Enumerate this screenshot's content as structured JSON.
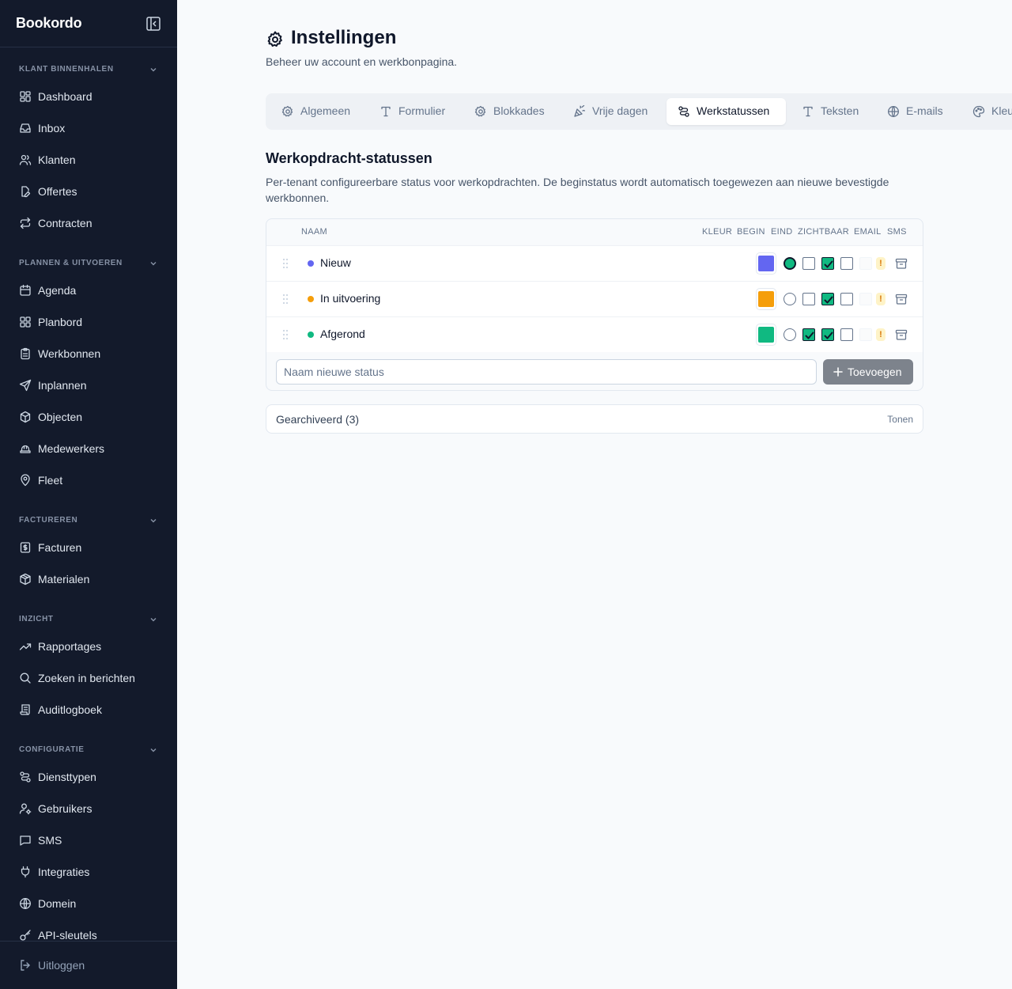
{
  "app": {
    "name": "Bookordo"
  },
  "sidebar": {
    "sections": [
      {
        "title": "Klant binnenhalen",
        "items": [
          {
            "label": "Dashboard",
            "icon": "dashboard-icon"
          },
          {
            "label": "Inbox",
            "icon": "inbox-icon"
          },
          {
            "label": "Klanten",
            "icon": "users-icon"
          },
          {
            "label": "Offertes",
            "icon": "file-edit-icon"
          },
          {
            "label": "Contracten",
            "icon": "repeat-icon"
          }
        ]
      },
      {
        "title": "Plannen & uitvoeren",
        "items": [
          {
            "label": "Agenda",
            "icon": "calendar-icon"
          },
          {
            "label": "Planbord",
            "icon": "board-icon"
          },
          {
            "label": "Werkbonnen",
            "icon": "clipboard-icon"
          },
          {
            "label": "Inplannen",
            "icon": "send-icon"
          },
          {
            "label": "Objecten",
            "icon": "objects-icon"
          },
          {
            "label": "Medewerkers",
            "icon": "hardhat-icon"
          },
          {
            "label": "Fleet",
            "icon": "map-pin-icon"
          }
        ]
      },
      {
        "title": "Factureren",
        "items": [
          {
            "label": "Facturen",
            "icon": "invoice-icon"
          },
          {
            "label": "Materialen",
            "icon": "package-icon"
          }
        ]
      },
      {
        "title": "Inzicht",
        "items": [
          {
            "label": "Rapportages",
            "icon": "trending-icon"
          },
          {
            "label": "Zoeken in berichten",
            "icon": "search-icon"
          },
          {
            "label": "Auditlogboek",
            "icon": "scroll-icon"
          }
        ]
      },
      {
        "title": "Configuratie",
        "items": [
          {
            "label": "Diensttypen",
            "icon": "route-icon"
          },
          {
            "label": "Gebruikers",
            "icon": "user-cog-icon"
          },
          {
            "label": "SMS",
            "icon": "message-icon"
          },
          {
            "label": "Integraties",
            "icon": "plug-icon"
          },
          {
            "label": "Domein",
            "icon": "globe-icon"
          },
          {
            "label": "API-sleutels",
            "icon": "key-icon"
          }
        ]
      }
    ],
    "logout": "Uitloggen"
  },
  "page": {
    "title": "Instellingen",
    "subtitle": "Beheer uw account en werkbonpagina."
  },
  "tabs": [
    {
      "label": "Algemeen",
      "icon": "gear-icon",
      "active": false
    },
    {
      "label": "Formulier",
      "icon": "type-icon",
      "active": false
    },
    {
      "label": "Blokkades",
      "icon": "gear-icon",
      "active": false
    },
    {
      "label": "Vrije dagen",
      "icon": "party-icon",
      "active": false
    },
    {
      "label": "Werkstatussen",
      "icon": "route-icon",
      "active": true
    },
    {
      "label": "Teksten",
      "icon": "type-icon",
      "active": false
    },
    {
      "label": "E-mails",
      "icon": "globe-icon",
      "active": false
    },
    {
      "label": "Kleuren",
      "icon": "palette-icon",
      "active": false
    }
  ],
  "section": {
    "title": "Werkopdracht-statussen",
    "description": "Per-tenant configureerbare status voor werkopdrachten. De beginstatus wordt automatisch toegewezen aan nieuwe bevestigde werkbonnen."
  },
  "table": {
    "headers": {
      "naam": "Naam",
      "kleur": "Kleur",
      "begin": "Begin",
      "eind": "Eind",
      "zichtbaar": "Zichtbaar",
      "email": "Email",
      "sms": "SMS"
    },
    "rows": [
      {
        "name": "Nieuw",
        "color": "#6366f1",
        "begin": true,
        "eind": false,
        "zichtbaar": true,
        "email": false,
        "sms_warning": "!"
      },
      {
        "name": "In uitvoering",
        "color": "#f59e0b",
        "begin": false,
        "eind": false,
        "zichtbaar": true,
        "email": false,
        "sms_warning": "!"
      },
      {
        "name": "Afgerond",
        "color": "#10b981",
        "begin": false,
        "eind": true,
        "zichtbaar": true,
        "email": false,
        "sms_warning": "!"
      }
    ],
    "new_status_placeholder": "Naam nieuwe status",
    "add_label": "Toevoegen"
  },
  "archived": {
    "label": "Gearchiveerd (3)",
    "toggle": "Tonen"
  }
}
